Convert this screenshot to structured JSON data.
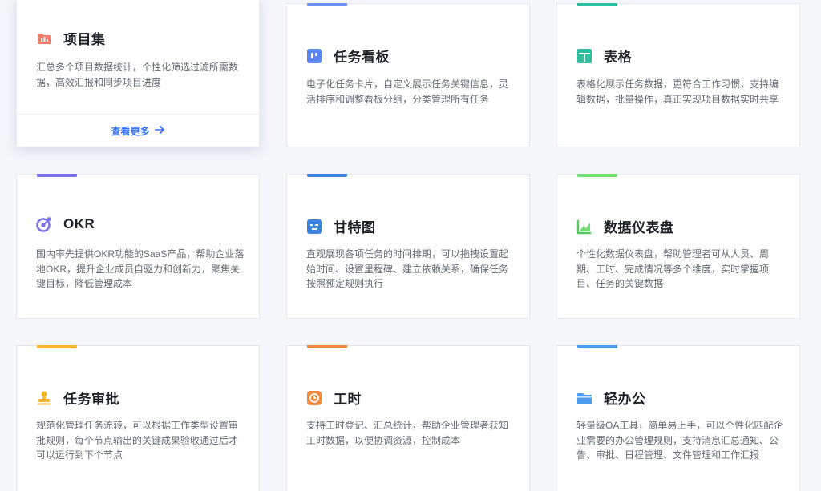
{
  "cards": [
    {
      "title": "项目集",
      "desc": "汇总多个项目数据统计，个性化筛选过滤所需数据，高效汇报和同步项目进度",
      "icon": "bar-chart-folder-icon",
      "accent": "#f27c6a",
      "more": "查看更多",
      "more_icon": "arrow-right-icon"
    },
    {
      "title": "任务看板",
      "desc": "电子化任务卡片，自定义展示任务关键信息，灵活排序和调整看板分组，分类管理所有任务",
      "icon": "kanban-board-icon",
      "accent": "#6e8ff2"
    },
    {
      "title": "表格",
      "desc": "表格化展示任务数据，更符合工作习惯，支持编辑数据，批量操作，真正实现项目数据实时共享",
      "icon": "table-icon",
      "accent": "#2dbd9f"
    },
    {
      "title": "OKR",
      "desc": "国内率先提供OKR功能的SaaS产品，帮助企业落地OKR，提升企业成员自驱力和创新力，聚焦关键目标，降低管理成本",
      "icon": "target-icon",
      "accent": "#7a74e8"
    },
    {
      "title": "甘特图",
      "desc": "直观展现各项任务的时间排期，可以拖拽设置起始时间、设置里程碑、建立依赖关系，确保任务按照预定规则执行",
      "icon": "gantt-icon",
      "accent": "#3c83e0"
    },
    {
      "title": "数据仪表盘",
      "desc": "个性化数据仪表盘，帮助管理者可从人员、周期、工时、完成情况等多个维度，实时掌握项目、任务的关键数据",
      "icon": "dashboard-chart-icon",
      "accent": "#6fdc74"
    },
    {
      "title": "任务审批",
      "desc": "规范化管理任务流转，可以根据工作类型设置审批规则，每个节点输出的关键成果验收通过后才可以运行到下个节点",
      "icon": "approval-stamp-icon",
      "accent": "#f5b731"
    },
    {
      "title": "工时",
      "desc": "支持工时登记、汇总统计，帮助企业管理者获知工时数据，以便协调资源，控制成本",
      "icon": "clock-icon",
      "accent": "#f0883e"
    },
    {
      "title": "轻办公",
      "desc": "轻量级OA工具，简单易上手，可以个性化匹配企业需要的办公管理规则，支持消息汇总通知、公告、审批、日程管理、文件管理和工作汇报",
      "icon": "folder-icon",
      "accent": "#4e9cf0"
    }
  ]
}
